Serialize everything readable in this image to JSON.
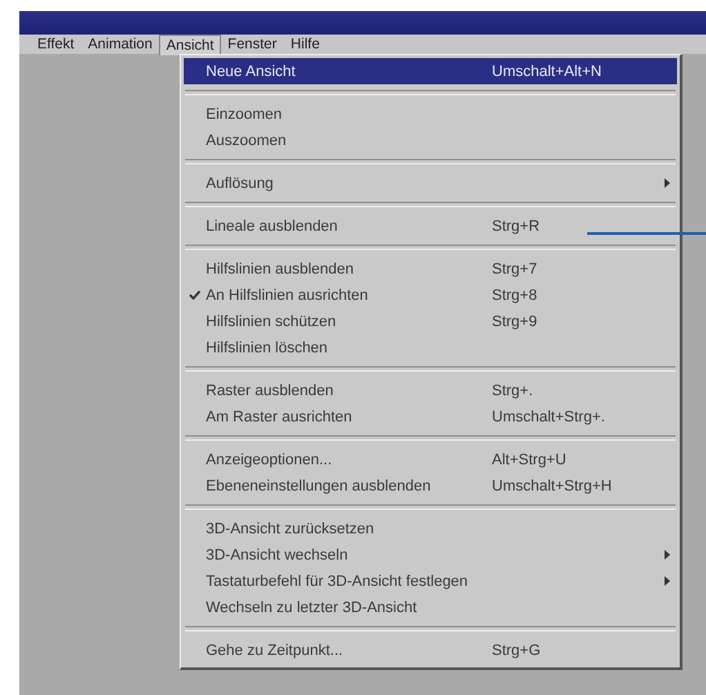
{
  "menubar": [
    {
      "label": "Effekt",
      "selected": false
    },
    {
      "label": "Animation",
      "selected": false
    },
    {
      "label": "Ansicht",
      "selected": true
    },
    {
      "label": "Fenster",
      "selected": false
    },
    {
      "label": "Hilfe",
      "selected": false
    }
  ],
  "menu": {
    "groups": [
      {
        "items": [
          {
            "label": "Neue Ansicht",
            "shortcut": "Umschalt+Alt+N",
            "checked": false,
            "submenu": false,
            "highlighted": true
          }
        ]
      },
      {
        "items": [
          {
            "label": "Einzoomen",
            "checked": false,
            "submenu": false,
            "highlighted": false
          },
          {
            "label": "Auszoomen",
            "checked": false,
            "submenu": false,
            "highlighted": false
          }
        ]
      },
      {
        "items": [
          {
            "label": "Auflösung",
            "checked": false,
            "submenu": true,
            "highlighted": false
          }
        ]
      },
      {
        "items": [
          {
            "label": "Lineale ausblenden",
            "shortcut": "Strg+R",
            "checked": false,
            "submenu": false,
            "highlighted": false
          }
        ]
      },
      {
        "items": [
          {
            "label": "Hilfslinien ausblenden",
            "shortcut": "Strg+7",
            "checked": false,
            "submenu": false,
            "highlighted": false
          },
          {
            "label": "An Hilfslinien ausrichten",
            "shortcut": "Strg+8",
            "checked": true,
            "submenu": false,
            "highlighted": false
          },
          {
            "label": "Hilfslinien schützen",
            "shortcut": "Strg+9",
            "checked": false,
            "submenu": false,
            "highlighted": false
          },
          {
            "label": "Hilfslinien löschen",
            "checked": false,
            "submenu": false,
            "highlighted": false
          }
        ]
      },
      {
        "items": [
          {
            "label": "Raster ausblenden",
            "shortcut": "Strg+.",
            "checked": false,
            "submenu": false,
            "highlighted": false
          },
          {
            "label": "Am Raster ausrichten",
            "shortcut": "Umschalt+Strg+.",
            "checked": false,
            "submenu": false,
            "highlighted": false
          }
        ]
      },
      {
        "items": [
          {
            "label": "Anzeigeoptionen...",
            "shortcut": "Alt+Strg+U",
            "checked": false,
            "submenu": false,
            "highlighted": false
          },
          {
            "label": "Ebeneneinstellungen ausblenden",
            "shortcut": "Umschalt+Strg+H",
            "checked": false,
            "submenu": false,
            "highlighted": false
          }
        ]
      },
      {
        "items": [
          {
            "label": "3D-Ansicht zurücksetzen",
            "checked": false,
            "submenu": false,
            "highlighted": false
          },
          {
            "label": "3D-Ansicht wechseln",
            "checked": false,
            "submenu": true,
            "highlighted": false
          },
          {
            "label": "Tastaturbefehl für 3D-Ansicht festlegen",
            "checked": false,
            "submenu": true,
            "highlighted": false
          },
          {
            "label": "Wechseln zu letzter 3D-Ansicht",
            "checked": false,
            "submenu": false,
            "highlighted": false
          }
        ]
      },
      {
        "items": [
          {
            "label": "Gehe zu Zeitpunkt...",
            "shortcut": "Strg+G",
            "checked": false,
            "submenu": false,
            "highlighted": false
          }
        ]
      }
    ]
  }
}
